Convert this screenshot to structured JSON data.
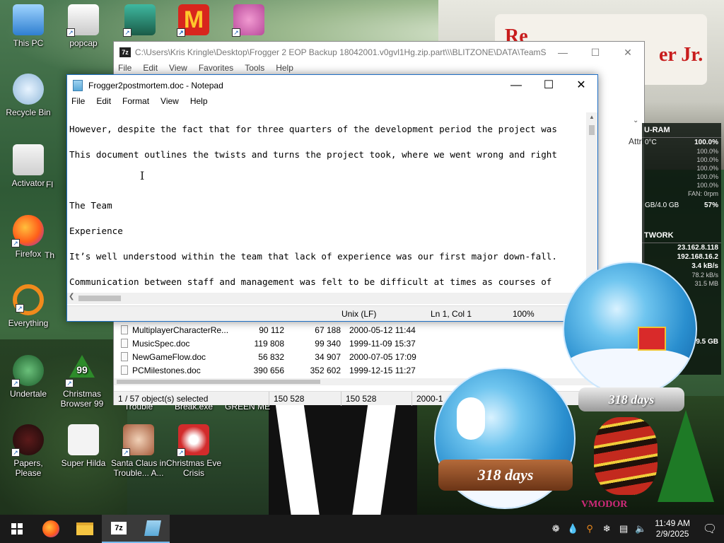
{
  "desktop_icons": [
    {
      "label": "This PC"
    },
    {
      "label": "popcap"
    },
    {
      "label": "Recycle Bin"
    },
    {
      "label": "Activator"
    },
    {
      "label": "Fl"
    },
    {
      "label": "Firefox"
    },
    {
      "label": "Th"
    },
    {
      "label": "Everything"
    },
    {
      "label": "Undertale"
    },
    {
      "label": "Christmas Browser 99"
    },
    {
      "label": "Trouble"
    },
    {
      "label": "Break.exe"
    },
    {
      "label": "GREEN ME"
    },
    {
      "label": "Papers, Please"
    },
    {
      "label": "Super Hilda"
    },
    {
      "label": "Santa Claus in Trouble... A..."
    },
    {
      "label": "Christmas Eve Crisis"
    }
  ],
  "wallpaper": {
    "sign_text_left": "Re",
    "sign_text_right": "er Jr."
  },
  "zip_window": {
    "title": "C:\\Users\\Kris Kringle\\Desktop\\Frogger 2 EOP Backup 18042001.v0gvl1Hg.zip.part\\\\\\BLITZONE\\DATA\\TeamSp...",
    "menu": [
      "File",
      "Edit",
      "View",
      "Favorites",
      "Tools",
      "Help"
    ],
    "column_attrib": "Attrib",
    "files": [
      {
        "name": "MultiplayerCharacterRe...",
        "size": "90 112",
        "packed": "67 188",
        "modified": "2000-05-12 11:44"
      },
      {
        "name": "MusicSpec.doc",
        "size": "119 808",
        "packed": "99 340",
        "modified": "1999-11-09 15:37"
      },
      {
        "name": "NewGameFlow.doc",
        "size": "56 832",
        "packed": "34 907",
        "modified": "2000-07-05 17:09"
      },
      {
        "name": "PCMilestones.doc",
        "size": "390 656",
        "packed": "352 602",
        "modified": "1999-12-15 11:27"
      }
    ],
    "status": {
      "selected": "1 / 57 object(s) selected",
      "size": "150 528",
      "packed": "150 528",
      "date": "2000-1"
    }
  },
  "notepad": {
    "title": "Frogger2postmortem.doc - Notepad",
    "menu": [
      "File",
      "Edit",
      "Format",
      "View",
      "Help"
    ],
    "lines": [
      "However, despite the fact that for three quarters of the development period the project was",
      "This document outlines the twists and turns the project took, where we went wrong and right",
      "",
      "The Team",
      "Experience",
      "It’s well understood within the team that lack of experience was our first major down-fall.",
      "Communication between staff and management was felt to be difficult at times as courses of"
    ],
    "status": {
      "line_ending": "Unix (LF)",
      "position": "Ln 1, Col 1",
      "zoom": "100%"
    }
  },
  "gadget": {
    "cpu_header": "U-RAM",
    "temp": "0°C",
    "cores": [
      "100.0%",
      "100.0%",
      "100.0%",
      "100.0%",
      "100.0%"
    ],
    "top_value": "100.0%",
    "fan": "FAN: 0rpm",
    "ram": "GB/4.0 GB",
    "ram_pct": "57%",
    "net_header": "TWORK",
    "ip1": "23.162.8.118",
    "ip2": "192.168.16.2",
    "rate1": "3.4 kB/s",
    "rate2": "78.2 kB/s",
    "rate3": "31.5 MB",
    "disk": "9.5 GB"
  },
  "snowglobes": [
    {
      "days": "318 days"
    },
    {
      "days": "318 days"
    }
  ],
  "wallpaper_corner_text": "VMODOR",
  "taskbar": {
    "apps": [
      "start",
      "firefox",
      "file-explorer",
      "7zip",
      "notepad"
    ],
    "time": "11:49 AM",
    "date": "2/9/2025"
  }
}
